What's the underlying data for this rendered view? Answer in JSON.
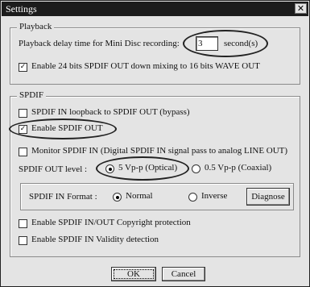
{
  "window": {
    "title": "Settings",
    "close_glyph": "✕"
  },
  "playback": {
    "legend": "Playback",
    "delay_label": "Playback delay time for Mini Disc recording:",
    "delay_value": "3",
    "delay_unit": "second(s)",
    "downmix_label": "Enable 24 bits SPDIF OUT down mixing to 16 bits WAVE OUT",
    "downmix_checked": true
  },
  "spdif": {
    "legend": "SPDIF",
    "loopback_label": "SPDIF IN loopback to SPDIF OUT (bypass)",
    "loopback_checked": false,
    "enable_out_label": "Enable SPDIF OUT",
    "enable_out_checked": true,
    "monitor_label": "Monitor SPDIF IN  (Digital SPDIF IN signal pass to analog LINE OUT)",
    "monitor_checked": false,
    "out_level_label": "SPDIF OUT level :",
    "optical_label": "5 Vp-p (Optical)",
    "optical_selected": true,
    "coaxial_label": "0.5 Vp-p (Coaxial)",
    "in_format_label": "SPDIF IN Format :",
    "normal_label": "Normal",
    "normal_selected": true,
    "inverse_label": "Inverse",
    "diagnose_label": "Diagnose",
    "copyright_label": "Enable SPDIF IN/OUT Copyright protection",
    "copyright_checked": false,
    "validity_label": "Enable SPDIF IN Validity detection",
    "validity_checked": false
  },
  "buttons": {
    "ok": "OK",
    "cancel": "Cancel"
  }
}
